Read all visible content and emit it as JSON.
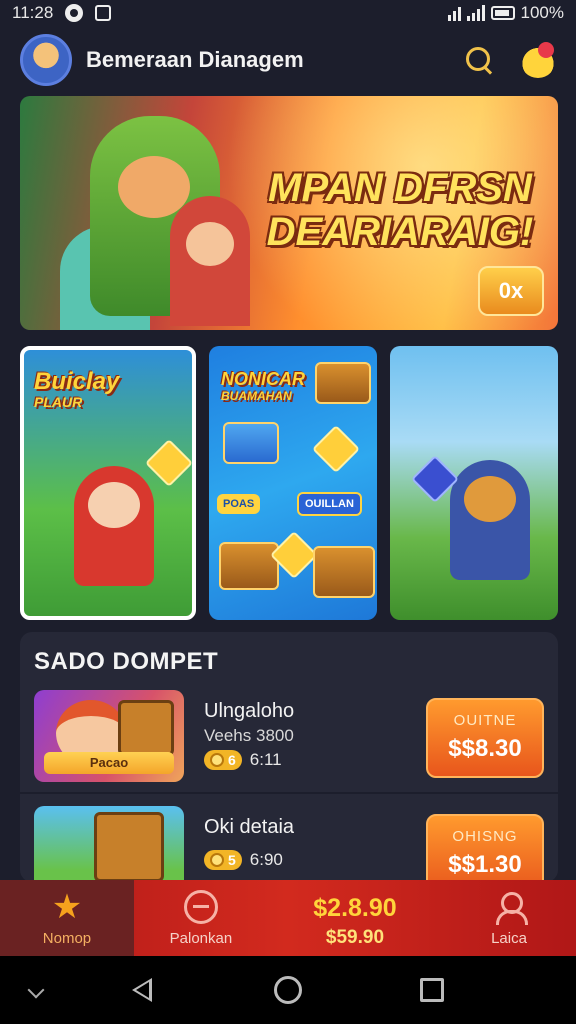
{
  "status_bar": {
    "time": "11:28",
    "battery_text": "100%"
  },
  "header": {
    "app_title": "Bemeraan Dianagem"
  },
  "hero": {
    "title_line1": "MPAN DFRSN",
    "title_line2": "DEARIARAIG!",
    "badge": "0x"
  },
  "cards": [
    {
      "logo": "Buiclay",
      "sub": "PLAUR"
    },
    {
      "logo": "NONICAR",
      "sub": "BUAMAHAN",
      "pill1": "POAS",
      "pill2": "OUILLAN"
    },
    {
      "logo": "",
      "sub": ""
    }
  ],
  "wallet": {
    "title": "SADO DOMPET",
    "items": [
      {
        "thumb_tag": "Pacao",
        "name": "Ulngaloho",
        "sub": "Veehs 3800",
        "chip": "6",
        "meta": "6:11",
        "button_label": "OUITNE",
        "price": "$$8.30"
      },
      {
        "thumb_tag": "",
        "name": "Oki detaia",
        "sub": "",
        "chip": "5",
        "meta": "6:90",
        "button_label": "OHISNG",
        "price": "$$1.30"
      }
    ]
  },
  "bottom_nav": {
    "home_label": "Nomop",
    "wheel_label": "Palonkan",
    "balance_big": "$2.8.90",
    "balance_small": "$59.90",
    "profile_label": "Laica"
  }
}
